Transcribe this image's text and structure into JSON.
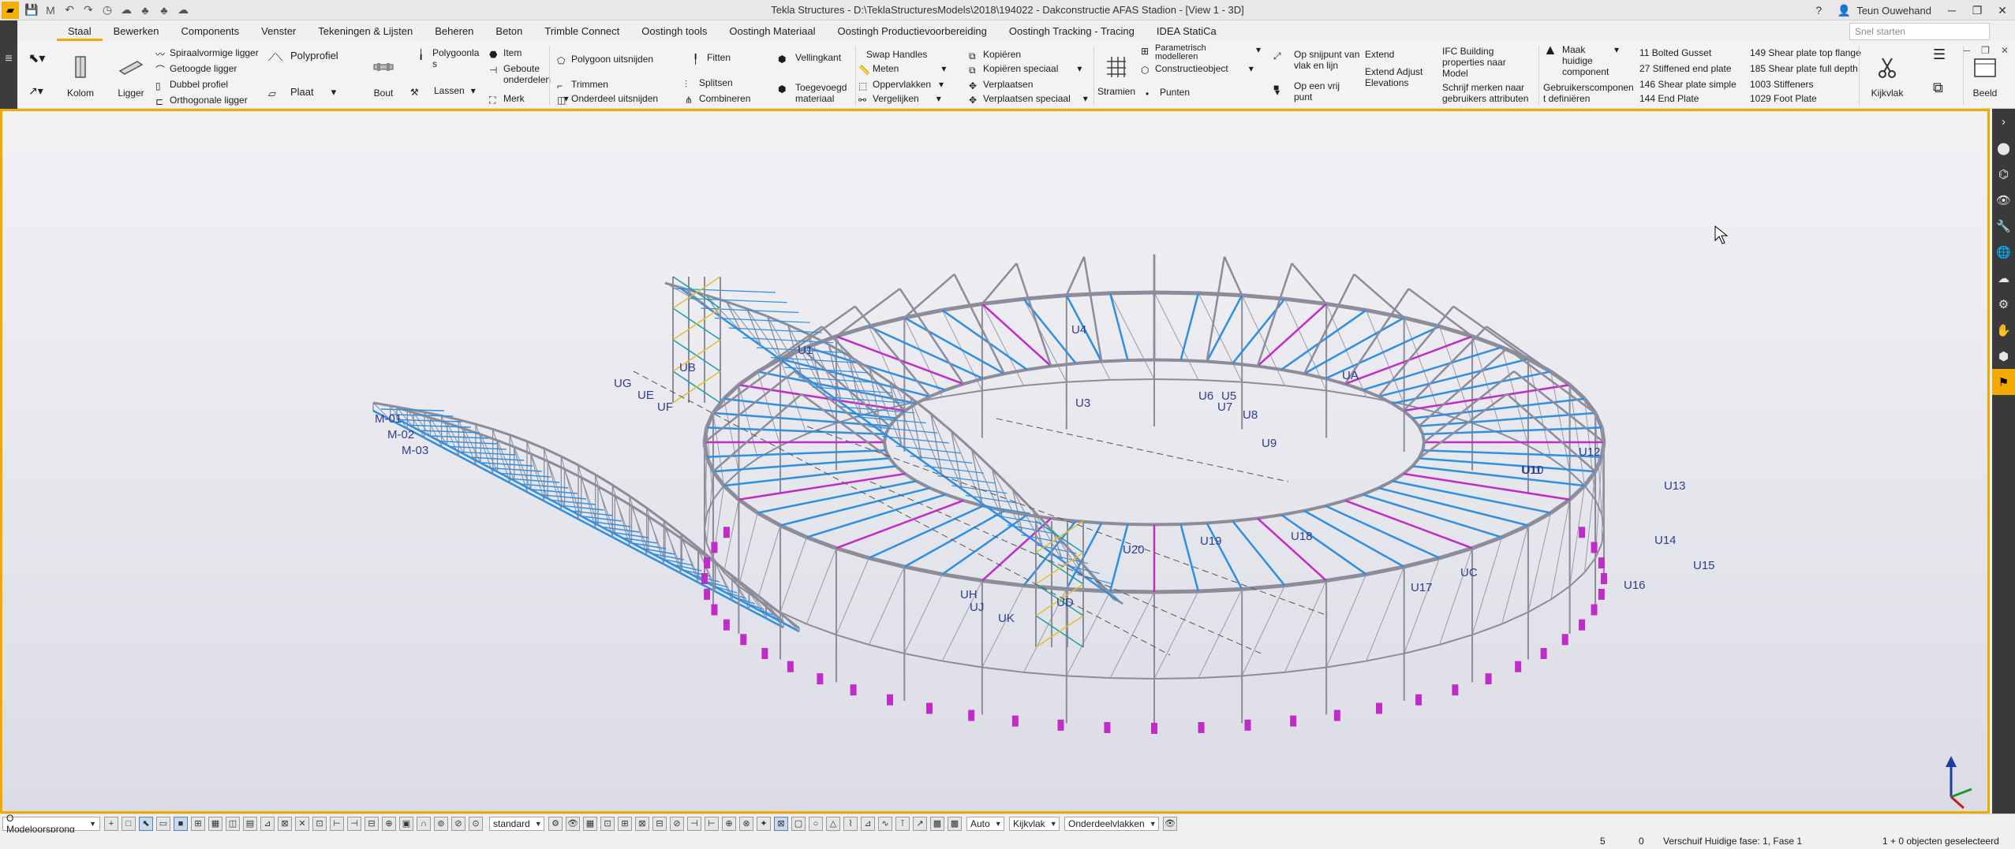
{
  "app": {
    "logo": "M",
    "title": "Tekla Structures - D:\\TeklaStructuresModels\\2018\\194022 - Dakconstructie AFAS Stadion - [View 1 - 3D]",
    "user": "Teun Ouwehand",
    "help_icon": "?",
    "search_placeholder": "Snel starten"
  },
  "tabs": [
    "Staal",
    "Bewerken",
    "Components",
    "Venster",
    "Tekeningen & Lijsten",
    "Beheren",
    "Beton",
    "Trimble Connect",
    "Oostingh tools",
    "Oostingh Materiaal",
    "Oostingh Productievoorbereiding",
    "Oostingh Tracking - Tracing",
    "IDEA StatiCa"
  ],
  "active_tab": "Staal",
  "ribbon": {
    "kolom": "Kolom",
    "ligger": "Ligger",
    "spiraalvormige": "Spiraalvormige ligger",
    "getoogde": "Getoogde ligger",
    "dubbel": "Dubbel profiel",
    "orthogonale": "Orthogonale ligger",
    "polyprofiel": "Polyprofiel",
    "plaat": "Plaat",
    "bout": "Bout",
    "polygoonlas": "Polygoonla s",
    "lassen": "Lassen",
    "item": "Item",
    "geboute": "Geboute onderdelen",
    "merk": "Merk",
    "polygoon_uitsnijden": "Polygoon uitsnijden",
    "trimmen": "Trimmen",
    "onderdeel_uitsnijden": "Onderdeel uitsnijden",
    "fitten": "Fitten",
    "splitsen": "Splitsen",
    "combineren": "Combineren",
    "vellingkant": "Vellingkant",
    "toegevoegd": "Toegevoegd materiaal",
    "swap_handles": "Swap Handles",
    "meten": "Meten",
    "oppervlakken": "Oppervlakken",
    "vergelijken": "Vergelijken",
    "kopieren": "Kopiëren",
    "kopieren_speciaal": "Kopiëren speciaal",
    "verplaatsen": "Verplaatsen",
    "verplaatsen_speciaal": "Verplaatsen speciaal",
    "stramien": "Stramien",
    "parametrisch": "Parametrisch modelleren",
    "constructieobject": "Constructieobject",
    "punten": "Punten",
    "op_snijpunt": "Op snijpunt van vlak en lijn",
    "op_een_vrij": "Op een vrij punt",
    "extend": "Extend",
    "extend_adjust": "Extend Adjust Elevations",
    "ifc_building": "IFC Building properties naar Model",
    "schrijf_merken": "Schrijf merken naar gebruikers attributen",
    "maak_huidige": "Maak huidige component",
    "gebruikerscomp": "Gebruikerscomponen t definiëren",
    "comp1": "11 Bolted Gusset",
    "comp2": "27 Stiffened end plate",
    "comp3": "146 Shear plate simple",
    "comp4": "144 End Plate",
    "comp5": "149 Shear plate top flange",
    "comp6": "185 Shear plate full depth",
    "comp7": "1003 Stiffeners",
    "comp8": "1029 Foot Plate",
    "kijkvlak": "Kijkvlak",
    "beeld": "Beeld"
  },
  "viewport_labels": [
    "UG",
    "UE",
    "UF",
    "UB",
    "U1",
    "U3",
    "U4",
    "U5",
    "U6",
    "U7",
    "U8",
    "U9",
    "U10",
    "U11",
    "U12",
    "U13",
    "U14",
    "U15",
    "U16",
    "U17",
    "U18",
    "U19",
    "U20",
    "UH",
    "UJ",
    "UK",
    "UD",
    "UC",
    "UA",
    "M-01",
    "M-02",
    "M-03"
  ],
  "bottombar": {
    "origin": "O Modeloorsprong",
    "standard": "standard",
    "auto": "Auto",
    "kijkvlak": "Kijkvlak",
    "onderdeelvlakken": "Onderdeelvlakken"
  },
  "status": {
    "count1": "5",
    "count2": "0",
    "phase": "Verschuif Huidige fase: 1, Fase 1",
    "selected": "1 + 0 objecten geselecteerd"
  },
  "colors": {
    "accent": "#f2a900",
    "steel_grey": "#8c8c9a",
    "steel_blue": "#2f8fe0",
    "steel_magenta": "#c02cc8",
    "label_blue": "#2d3f8e"
  }
}
